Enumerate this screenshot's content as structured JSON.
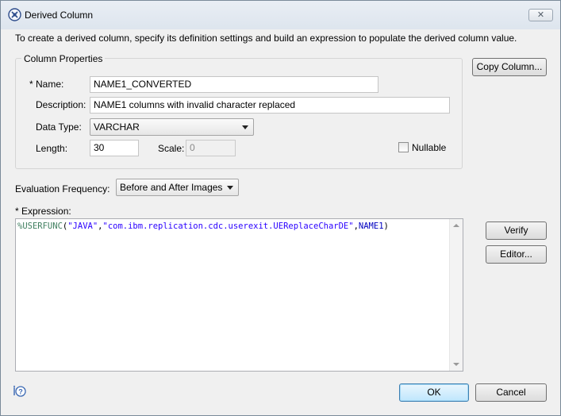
{
  "window": {
    "title": "Derived Column",
    "close_label": "✕"
  },
  "intro": "To create a derived column, specify its definition settings and build an expression to populate the derived column value.",
  "column_properties": {
    "group_title": "Column Properties",
    "name_label": "* Name:",
    "name_value": "NAME1_CONVERTED",
    "description_label": "Description:",
    "description_value": "NAME1 columns with invalid character replaced",
    "data_type_label": "Data Type:",
    "data_type_value": "VARCHAR",
    "length_label": "Length:",
    "length_value": "30",
    "scale_label": "Scale:",
    "scale_value": "0",
    "nullable_label": "Nullable",
    "nullable_checked": false
  },
  "copy_column_button": "Copy Column...",
  "evaluation": {
    "label": "Evaluation Frequency:",
    "value": "Before and After Images"
  },
  "expression": {
    "label": "* Expression:",
    "parts": {
      "func": "%USERFUNC",
      "open": "(",
      "arg1": "\"JAVA\"",
      "comma1": ",",
      "arg2": "\"com.ibm.replication.cdc.userexit.UEReplaceCharDE\"",
      "comma2": ",",
      "arg3": "NAME1",
      "close": ")"
    }
  },
  "buttons": {
    "verify": "Verify",
    "editor": "Editor...",
    "ok": "OK",
    "cancel": "Cancel"
  },
  "icons": {
    "title": "derived-column-icon",
    "help": "help-icon"
  }
}
